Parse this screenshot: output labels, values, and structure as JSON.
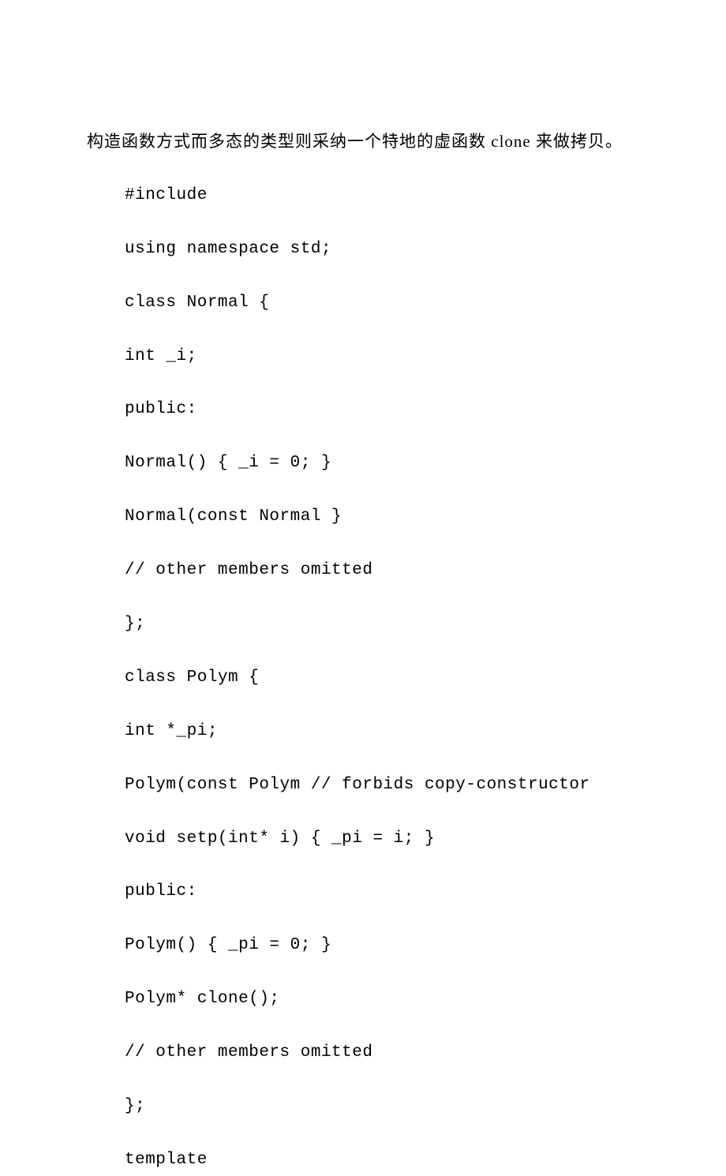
{
  "intro": "构造函数方式而多态的类型则采纳一个特地的虚函数 clone 来做拷贝。",
  "code": {
    "line1": "#include",
    "line2": "using namespace std;",
    "line3": "class Normal {",
    "line4": "int _i;",
    "line5": "public:",
    "line6": "Normal() { _i = 0; }",
    "line7": "Normal(const Normal }",
    "line8": "// other members omitted",
    "line9": "};",
    "line10": "class Polym {",
    "line11": "int *_pi;",
    "line12": "Polym(const Polym // forbids copy-constructor",
    "line13": "void setp(int* i) { _pi = i; }",
    "line14": "public:",
    "line15": "Polym() { _pi = 0; }",
    "line16": "Polym* clone();",
    "line17": "// other members omitted",
    "line18": "};",
    "line19": "template"
  }
}
